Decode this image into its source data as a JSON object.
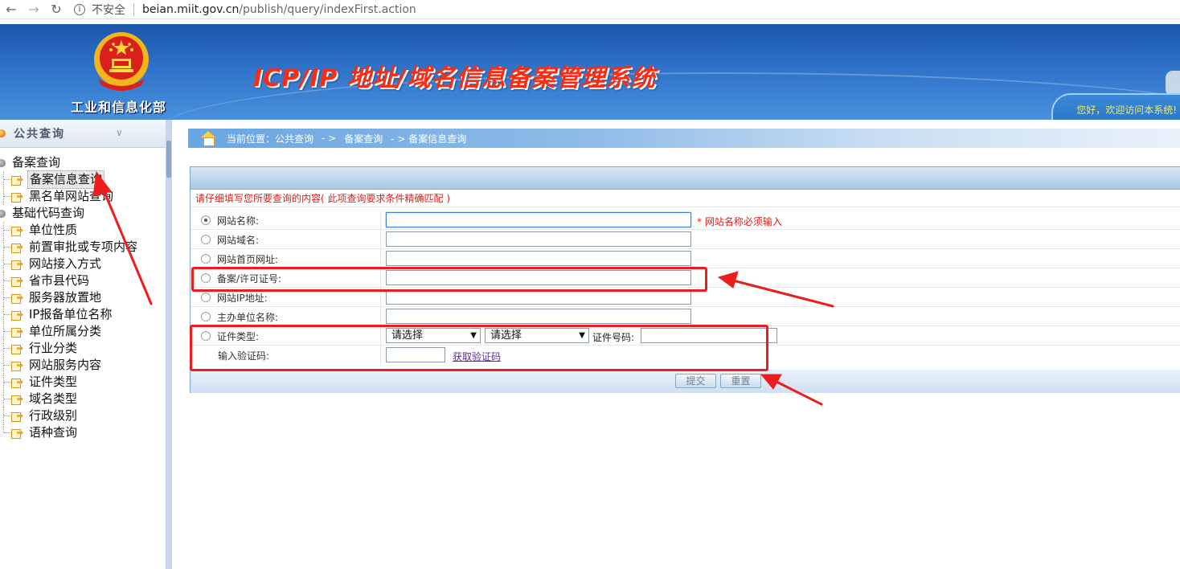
{
  "browser": {
    "back_icon": "arrow-left-icon",
    "forward_icon": "arrow-right-icon",
    "reload_icon": "reload-icon",
    "security_text": "不安全",
    "url_host": "beian.miit.gov.cn",
    "url_path": "/publish/query/indexFirst.action"
  },
  "header": {
    "ministry": "工业和信息化部",
    "system_title": "ICP/IP 地址/域名信息备案管理系统",
    "welcome": "您好，欢迎访问本系统!"
  },
  "sidebar": {
    "title": "公共查询",
    "groups": [
      {
        "label": "备案查询",
        "items": [
          "备案信息查询",
          "黑名单网站查询"
        ]
      },
      {
        "label": "基础代码查询",
        "items": [
          "单位性质",
          "前置审批或专项内容",
          "网站接入方式",
          "省市县代码",
          "服务器放置地",
          "IP报备单位名称",
          "单位所属分类",
          "行业分类",
          "网站服务内容",
          "证件类型",
          "域名类型",
          "行政级别",
          "语种查询"
        ]
      }
    ],
    "selected": "备案信息查询"
  },
  "breadcrumb": {
    "current_label": "当前位置：公共查询",
    "sep1": "- >",
    "level2": "备案查询",
    "level3": "- > 备案信息查询"
  },
  "form": {
    "hint": "请仔细填写您所要查询的内容( 此项查询要求条件精确匹配 )",
    "fields": [
      {
        "label": "网站名称:",
        "value": "",
        "required_note": "* 网站名称必须输入",
        "selected": true
      },
      {
        "label": "网站域名:",
        "value": ""
      },
      {
        "label": "网站首页网址:",
        "value": ""
      },
      {
        "label": "备案/许可证号:",
        "value": ""
      },
      {
        "label": "网站IP地址:",
        "value": ""
      },
      {
        "label": "主办单位名称:",
        "value": ""
      }
    ],
    "cert_type_label": "证件类型:",
    "cert_type_select1": "请选择",
    "cert_type_select2": "请选择",
    "cert_no_label": "证件号码:",
    "cert_no_value": "",
    "captcha_label": "输入验证码:",
    "captcha_value": "",
    "captcha_link": "获取验证码",
    "submit": "提交",
    "reset": "重置"
  },
  "colors": {
    "annotation_red": "#ee1c1c",
    "banner_blue": "#2f72c8",
    "title_red": "#ff2a12"
  }
}
